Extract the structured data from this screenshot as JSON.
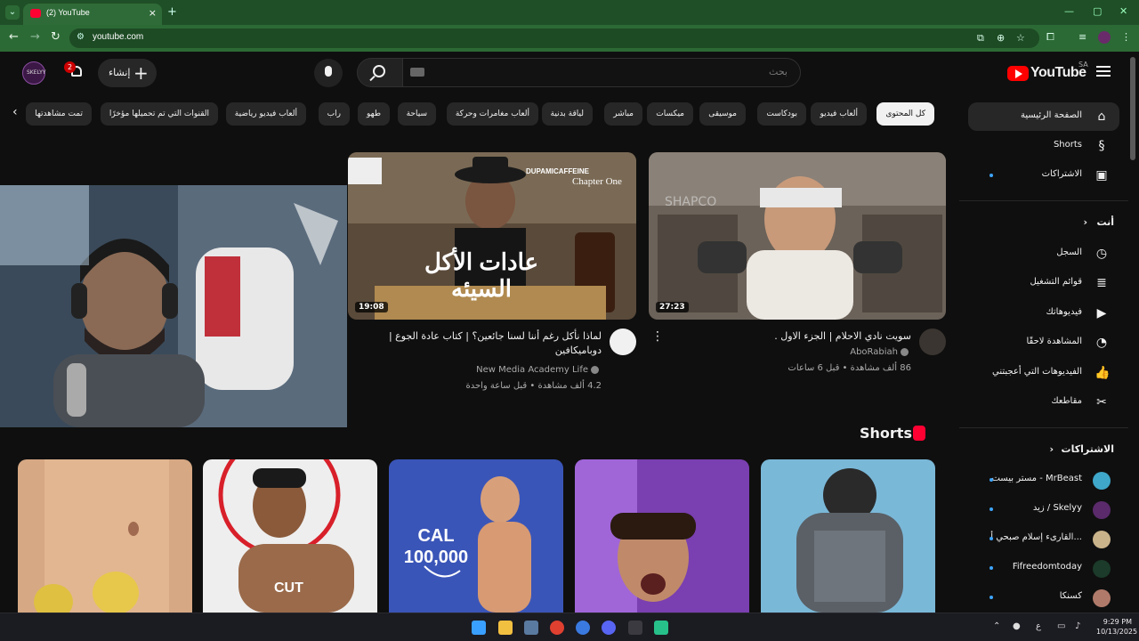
{
  "browser": {
    "tab_title": "(2) YouTube",
    "url": "youtube.com",
    "colors": {
      "frame": "#1f4f27",
      "toolbar": "#2c6a35"
    }
  },
  "masthead": {
    "logo_text": "YouTube",
    "region": "SA",
    "search_placeholder": "بحث",
    "create_label": "إنشاء",
    "notification_count": "2",
    "avatar_text": "SKELYY"
  },
  "chips": [
    "كل المحتوى",
    "ألعاب فيديو",
    "بودكاست",
    "موسيقى",
    "ميكسات",
    "مباشر",
    "لياقة بدنية",
    "ألعاب مغامرات وحركة",
    "سياحة",
    "طهو",
    "راب",
    "ألعاب فيديو رياضية",
    "القنوات التي تم تحميلها مؤخرًا",
    "تمت مشاهدتها"
  ],
  "sidebar": {
    "main": [
      {
        "label": "الصفحة الرئيسية",
        "icon": "home-icon"
      },
      {
        "label": "Shorts",
        "icon": "shorts-icon"
      },
      {
        "label": "الاشتراكات",
        "icon": "subscriptions-icon"
      }
    ],
    "you_heading": "أنت",
    "you_items": [
      {
        "label": "السجل",
        "icon": "history-icon"
      },
      {
        "label": "قوائم التشغيل",
        "icon": "playlists-icon"
      },
      {
        "label": "فيديوهاتك",
        "icon": "your-videos-icon"
      },
      {
        "label": "المشاهدة لاحقًا",
        "icon": "watch-later-icon"
      },
      {
        "label": "الفيديوهات التي أعجبتني",
        "icon": "liked-icon"
      },
      {
        "label": "مقاطعك",
        "icon": "clips-icon"
      }
    ],
    "subs_heading": "الاشتراكات",
    "subscriptions": [
      {
        "label": "مستر بيست - MrBeast",
        "color": "#3fa7c9"
      },
      {
        "label": "زيد / Skelyy",
        "color": "#5a2a6b"
      },
      {
        "label": "القارىء إسلام صبحي أ...",
        "color": "#c9b38a"
      },
      {
        "label": "Fifreedomtoday",
        "color": "#1c3b2a"
      },
      {
        "label": "كسنكا",
        "color": "#b07a6a"
      }
    ]
  },
  "videos": [
    {
      "title": "سويت نادي الاحلام | الجزء الاول .",
      "channel": "AboRabiah",
      "meta": "86 ألف مشاهدة • قبل 6 ساعات",
      "duration": "27:23"
    },
    {
      "title": "لماذا نأكل رغم أننا لسنا جائعين؟ | كتاب عادة الجوع | دوباميكافين",
      "channel": "New Media Academy Life",
      "meta": "4.2 ألف مشاهدة • قبل ساعة واحدة",
      "duration": "19:08",
      "thumb_text": "عادات الأكل السيئه",
      "thumb_tag": "DUPAMICAFFEINE",
      "thumb_tag2": "Chapter One"
    }
  ],
  "shorts": {
    "heading": "Shorts",
    "items": [
      {
        "caption": ""
      },
      {
        "caption": ""
      },
      {
        "caption": ""
      },
      {
        "caption": "CAL 100,000"
      },
      {
        "caption": "CUT"
      }
    ]
  },
  "taskbar": {
    "time": "9:29 PM",
    "date": "10/13/2025",
    "lang": "ع"
  }
}
